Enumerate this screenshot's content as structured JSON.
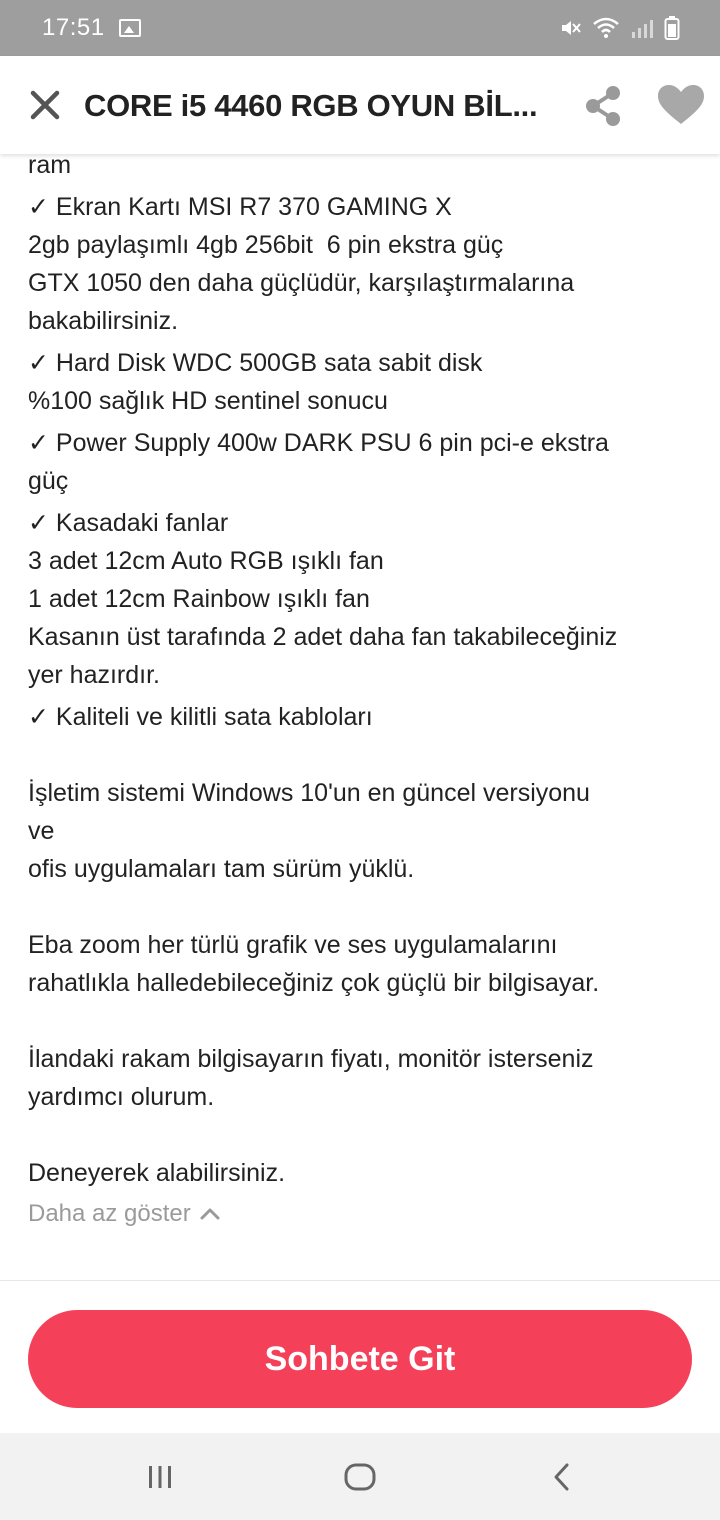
{
  "status_bar": {
    "time": "17:51"
  },
  "header": {
    "title": "CORE i5 4460 RGB OYUN BİL...",
    "icons": [
      "close-icon",
      "share-icon",
      "heart-icon"
    ]
  },
  "description": {
    "lines": [
      "ram",
      "✓ Ekran Kartı MSI R7 370 GAMING X",
      "2gb paylaşımlı 4gb 256bit  6 pin ekstra güç",
      "GTX 1050 den daha güçlüdür, karşılaştırmalarına",
      "bakabilirsiniz.",
      "✓ Hard Disk WDC 500GB sata sabit disk",
      "%100 sağlık HD sentinel sonucu",
      "✓ Power Supply 400w DARK PSU 6 pin pci-e ekstra",
      "güç",
      "✓ Kasadaki fanlar",
      "3 adet 12cm Auto RGB ışıklı fan",
      "1 adet 12cm Rainbow ışıklı fan",
      "Kasanın üst tarafında 2 adet daha fan takabileceğiniz",
      "yer hazırdır.",
      "✓ Kaliteli ve kilitli sata kabloları",
      "",
      "İşletim sistemi Windows 10'un en güncel versiyonu",
      "ve",
      "ofis uygulamaları tam sürüm yüklü.",
      "",
      "Eba zoom her türlü grafik ve ses uygulamalarını",
      "rahatlıkla halledebileceğiniz çok güçlü bir bilgisayar.",
      "",
      "İlandaki rakam bilgisayarın fiyatı, monitör isterseniz",
      "yardımcı olurum.",
      "",
      "Deneyerek alabilirsiniz."
    ]
  },
  "show_less": {
    "label": "Daha az göster"
  },
  "actions": {
    "chat_label": "Sohbete Git"
  },
  "colors": {
    "accent": "#f5405a",
    "status_bar": "#9e9e9e",
    "muted_text": "#9a9a9a"
  }
}
